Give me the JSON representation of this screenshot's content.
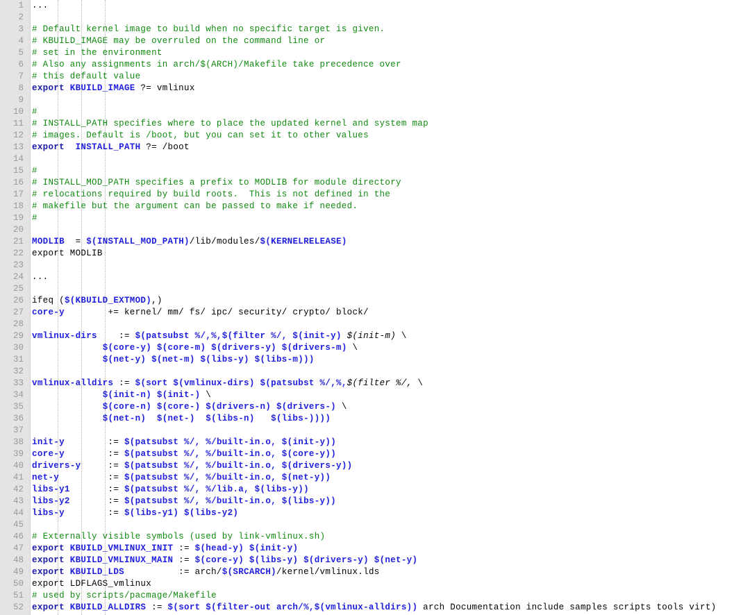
{
  "editor": {
    "title": "Makefile source view",
    "language": "Makefile",
    "first_line_number": 1,
    "last_line_number": 52,
    "colors": {
      "background": "#ffffff",
      "gutter_background": "#e4e4e4",
      "gutter_border": "#d0d0d0",
      "line_number": "#999999",
      "comment": "#118a11",
      "variable": "#2020dd",
      "keyword": "#1a1aa8",
      "plain": "#000000",
      "indent_guide": "#b4b4b4"
    },
    "indent_guide_x": [
      83,
      117,
      151
    ]
  },
  "lines": [
    {
      "n": "1",
      "tokens": [
        {
          "t": "pln",
          "s": "..."
        }
      ]
    },
    {
      "n": "2",
      "tokens": []
    },
    {
      "n": "3",
      "tokens": [
        {
          "t": "com",
          "s": "# Default kernel image to build when no specific target is given."
        }
      ]
    },
    {
      "n": "4",
      "tokens": [
        {
          "t": "com",
          "s": "# KBUILD_IMAGE may be overruled on the command line or"
        }
      ]
    },
    {
      "n": "5",
      "tokens": [
        {
          "t": "com",
          "s": "# set in the environment"
        }
      ]
    },
    {
      "n": "6",
      "tokens": [
        {
          "t": "com",
          "s": "# Also any assignments in arch/$(ARCH)/Makefile take precedence over"
        }
      ]
    },
    {
      "n": "7",
      "tokens": [
        {
          "t": "com",
          "s": "# this default value"
        }
      ]
    },
    {
      "n": "8",
      "tokens": [
        {
          "t": "kw",
          "s": "export "
        },
        {
          "t": "var",
          "s": "KBUILD_IMAGE"
        },
        {
          "t": "pln",
          "s": " ?= vmlinux"
        }
      ]
    },
    {
      "n": "9",
      "tokens": []
    },
    {
      "n": "10",
      "tokens": [
        {
          "t": "com",
          "s": "#"
        }
      ]
    },
    {
      "n": "11",
      "tokens": [
        {
          "t": "com",
          "s": "# INSTALL_PATH specifies where to place the updated kernel and system map"
        }
      ]
    },
    {
      "n": "12",
      "tokens": [
        {
          "t": "com",
          "s": "# images. Default is /boot, but you can set it to other values"
        }
      ]
    },
    {
      "n": "13",
      "tokens": [
        {
          "t": "kw",
          "s": "export  "
        },
        {
          "t": "var",
          "s": "INSTALL_PATH"
        },
        {
          "t": "pln",
          "s": " ?= /boot"
        }
      ]
    },
    {
      "n": "14",
      "tokens": []
    },
    {
      "n": "15",
      "tokens": [
        {
          "t": "com",
          "s": "#"
        }
      ]
    },
    {
      "n": "16",
      "tokens": [
        {
          "t": "com",
          "s": "# INSTALL_MOD_PATH specifies a prefix to MODLIB for module directory"
        }
      ]
    },
    {
      "n": "17",
      "tokens": [
        {
          "t": "com",
          "s": "# relocations required by build roots.  This is not defined in the"
        }
      ]
    },
    {
      "n": "18",
      "tokens": [
        {
          "t": "com",
          "s": "# makefile but the argument can be passed to make if needed."
        }
      ]
    },
    {
      "n": "19",
      "tokens": [
        {
          "t": "com",
          "s": "#"
        }
      ]
    },
    {
      "n": "20",
      "tokens": []
    },
    {
      "n": "21",
      "tokens": [
        {
          "t": "var",
          "s": "MODLIB"
        },
        {
          "t": "pln",
          "s": "  = "
        },
        {
          "t": "var",
          "s": "$(INSTALL_MOD_PATH)"
        },
        {
          "t": "pln",
          "s": "/lib/modules/"
        },
        {
          "t": "var",
          "s": "$(KERNELRELEASE)"
        }
      ]
    },
    {
      "n": "22",
      "tokens": [
        {
          "t": "pln",
          "s": "export MODLIB"
        }
      ]
    },
    {
      "n": "23",
      "tokens": []
    },
    {
      "n": "24",
      "tokens": [
        {
          "t": "pln",
          "s": "..."
        }
      ]
    },
    {
      "n": "25",
      "tokens": []
    },
    {
      "n": "26",
      "tokens": [
        {
          "t": "pln",
          "s": "ifeq ("
        },
        {
          "t": "var",
          "s": "$(KBUILD_EXTMOD)"
        },
        {
          "t": "pln",
          "s": ",)"
        }
      ]
    },
    {
      "n": "27",
      "tokens": [
        {
          "t": "var",
          "s": "core-y"
        },
        {
          "t": "pln",
          "s": "        += kernel/ mm/ fs/ ipc/ security/ crypto/ block/"
        }
      ]
    },
    {
      "n": "28",
      "tokens": []
    },
    {
      "n": "29",
      "tokens": [
        {
          "t": "var",
          "s": "vmlinux-dirs"
        },
        {
          "t": "pln",
          "s": "    := "
        },
        {
          "t": "var",
          "s": "$(patsubst %/,%,$(filter %/, $(init-y)"
        },
        {
          "t": "pln",
          "s": " "
        },
        {
          "t": "ital",
          "s": "$(init-m)"
        },
        {
          "t": "pln",
          "s": " \\"
        }
      ]
    },
    {
      "n": "30",
      "tokens": [
        {
          "t": "pln",
          "s": "             "
        },
        {
          "t": "var",
          "s": "$(core-y) $(core-m) $(drivers-y) $(drivers-m)"
        },
        {
          "t": "pln",
          "s": " \\"
        }
      ]
    },
    {
      "n": "31",
      "tokens": [
        {
          "t": "pln",
          "s": "             "
        },
        {
          "t": "var",
          "s": "$(net-y) $(net-m) $(libs-y) $(libs-m)))"
        }
      ]
    },
    {
      "n": "32",
      "tokens": []
    },
    {
      "n": "33",
      "tokens": [
        {
          "t": "var",
          "s": "vmlinux-alldirs"
        },
        {
          "t": "pln",
          "s": " := "
        },
        {
          "t": "var",
          "s": "$(sort $(vmlinux-dirs) $(patsubst %/,%,"
        },
        {
          "t": "ital",
          "s": "$(filter %/,"
        },
        {
          "t": "pln",
          "s": " \\"
        }
      ]
    },
    {
      "n": "34",
      "tokens": [
        {
          "t": "pln",
          "s": "             "
        },
        {
          "t": "var",
          "s": "$(init-n) $(init-)"
        },
        {
          "t": "pln",
          "s": " \\"
        }
      ]
    },
    {
      "n": "35",
      "tokens": [
        {
          "t": "pln",
          "s": "             "
        },
        {
          "t": "var",
          "s": "$(core-n) $(core-) $(drivers-n) $(drivers-)"
        },
        {
          "t": "pln",
          "s": " \\"
        }
      ]
    },
    {
      "n": "36",
      "tokens": [
        {
          "t": "pln",
          "s": "             "
        },
        {
          "t": "var",
          "s": "$(net-n)  $(net-)  $(libs-n)   $(libs-))))"
        }
      ]
    },
    {
      "n": "37",
      "tokens": []
    },
    {
      "n": "38",
      "tokens": [
        {
          "t": "var",
          "s": "init-y"
        },
        {
          "t": "pln",
          "s": "        := "
        },
        {
          "t": "var",
          "s": "$(patsubst %/, %/built-in.o, $(init-y))"
        }
      ]
    },
    {
      "n": "39",
      "tokens": [
        {
          "t": "var",
          "s": "core-y"
        },
        {
          "t": "pln",
          "s": "        := "
        },
        {
          "t": "var",
          "s": "$(patsubst %/, %/built-in.o, $(core-y))"
        }
      ]
    },
    {
      "n": "40",
      "tokens": [
        {
          "t": "var",
          "s": "drivers-y"
        },
        {
          "t": "pln",
          "s": "     := "
        },
        {
          "t": "var",
          "s": "$(patsubst %/, %/built-in.o, $(drivers-y))"
        }
      ]
    },
    {
      "n": "41",
      "tokens": [
        {
          "t": "var",
          "s": "net-y"
        },
        {
          "t": "pln",
          "s": "         := "
        },
        {
          "t": "var",
          "s": "$(patsubst %/, %/built-in.o, $(net-y))"
        }
      ]
    },
    {
      "n": "42",
      "tokens": [
        {
          "t": "var",
          "s": "libs-y1"
        },
        {
          "t": "pln",
          "s": "       := "
        },
        {
          "t": "var",
          "s": "$(patsubst %/, %/lib.a, $(libs-y))"
        }
      ]
    },
    {
      "n": "43",
      "tokens": [
        {
          "t": "var",
          "s": "libs-y2"
        },
        {
          "t": "pln",
          "s": "       := "
        },
        {
          "t": "var",
          "s": "$(patsubst %/, %/built-in.o, $(libs-y))"
        }
      ]
    },
    {
      "n": "44",
      "tokens": [
        {
          "t": "var",
          "s": "libs-y"
        },
        {
          "t": "pln",
          "s": "        := "
        },
        {
          "t": "var",
          "s": "$(libs-y1) $(libs-y2)"
        }
      ]
    },
    {
      "n": "45",
      "tokens": []
    },
    {
      "n": "46",
      "tokens": [
        {
          "t": "com",
          "s": "# Externally visible symbols (used by link-vmlinux.sh)"
        }
      ]
    },
    {
      "n": "47",
      "tokens": [
        {
          "t": "kw",
          "s": "export "
        },
        {
          "t": "var",
          "s": "KBUILD_VMLINUX_INIT"
        },
        {
          "t": "pln",
          "s": " := "
        },
        {
          "t": "var",
          "s": "$(head-y) $(init-y)"
        }
      ]
    },
    {
      "n": "48",
      "tokens": [
        {
          "t": "kw",
          "s": "export "
        },
        {
          "t": "var",
          "s": "KBUILD_VMLINUX_MAIN"
        },
        {
          "t": "pln",
          "s": " := "
        },
        {
          "t": "var",
          "s": "$(core-y) $(libs-y) $(drivers-y) $(net-y)"
        }
      ]
    },
    {
      "n": "49",
      "tokens": [
        {
          "t": "kw",
          "s": "export "
        },
        {
          "t": "var",
          "s": "KBUILD_LDS"
        },
        {
          "t": "pln",
          "s": "          := arch/"
        },
        {
          "t": "var",
          "s": "$(SRCARCH)"
        },
        {
          "t": "pln",
          "s": "/kernel/vmlinux.lds"
        }
      ]
    },
    {
      "n": "50",
      "tokens": [
        {
          "t": "pln",
          "s": "export LDFLAGS_vmlinux"
        }
      ]
    },
    {
      "n": "51",
      "tokens": [
        {
          "t": "com",
          "s": "# used by scripts/pacmage/Makefile"
        }
      ]
    },
    {
      "n": "52",
      "tokens": [
        {
          "t": "kw",
          "s": "export "
        },
        {
          "t": "var",
          "s": "KBUILD_ALLDIRS"
        },
        {
          "t": "pln",
          "s": " := "
        },
        {
          "t": "var",
          "s": "$(sort $(filter-out arch/%,$(vmlinux-alldirs))"
        },
        {
          "t": "pln",
          "s": " arch Documentation include samples scripts tools virt)"
        }
      ]
    }
  ]
}
